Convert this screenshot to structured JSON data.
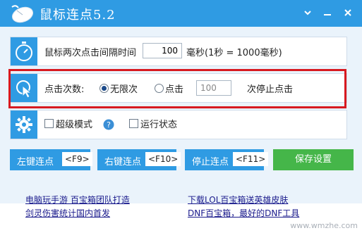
{
  "app": {
    "title": "鼠标连点5.2"
  },
  "titlebar": {
    "dropdown_icon": "chevron-down-icon",
    "minimize_icon": "minimize-icon",
    "close_icon": "close-icon"
  },
  "interval": {
    "label": "鼠标两次点击间隔时间",
    "value": "100",
    "unit": "毫秒(1秒 = 1000毫秒)"
  },
  "clicks": {
    "label": "点击次数:",
    "unlimited_label": "无限次",
    "count_label": "点击",
    "count_value": "100",
    "suffix": "次停止点击",
    "selected": "unlimited"
  },
  "options": {
    "super_mode_label": "超级模式",
    "run_status_label": "运行状态",
    "help_icon": "question-icon"
  },
  "buttons": {
    "left_click": {
      "label": "左键连点",
      "key": "<F9>"
    },
    "right_click": {
      "label": "右键连点",
      "key": "<F10>"
    },
    "stop_click": {
      "label": "停止连点",
      "key": "<F11>"
    },
    "save": "保存设置"
  },
  "links": {
    "left_1": "电脑玩手游 百宝箱团队打造",
    "left_2": "剑灵伤害统计国内首发",
    "right_1": "下载LOL百宝箱送英雄皮肤",
    "right_2": "DNF百宝箱，最好的DNF工具"
  },
  "watermark": "www.wmzhe.com",
  "colors": {
    "accent": "#2f9be3",
    "save": "#45b649",
    "highlight": "#d71920"
  }
}
